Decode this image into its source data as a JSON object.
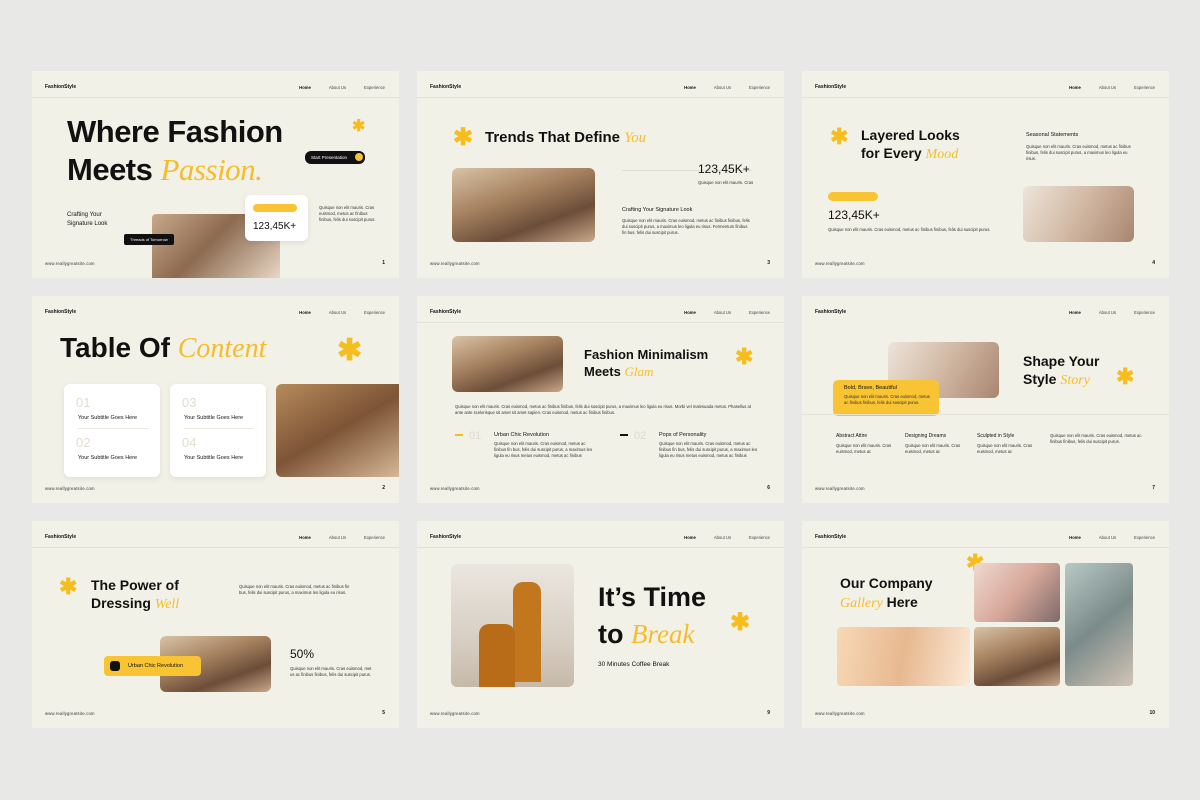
{
  "common": {
    "brand": "FashionStyle",
    "nav": [
      "Home",
      "About Us",
      "Experience"
    ],
    "site": "www.reallygreatsite.com"
  },
  "s1": {
    "title1": "Where Fashion",
    "title2": "Meets",
    "title_accent": "Passion.",
    "sub": "Crafting Your Signature Look",
    "btn": "Start Presentation",
    "stat": "123,45K+",
    "pill": "Threads of Tomorrow",
    "body": "Quisque non elit mauris. Cras euismod, metus ac finibus finibus, felis dui suscipit purus.",
    "page": "1"
  },
  "s2": {
    "title1": "Trends That Define",
    "title_accent": "You",
    "stat": "123,45K+",
    "stat_note": "Quisque non elit mauris. Cras",
    "sub": "Crafting Your Signature Look",
    "body": "Quisque non elit mauris. Cras euismod, metus ac finibus finibus, felis dui suscipit purus, a maximus leo ligula eu risus. Fermentum finibus fin bus, felis dui suscipit purus.",
    "page": "3"
  },
  "s3": {
    "title1": "Layered Looks",
    "title2": "for Every",
    "title_accent": "Mood",
    "stat": "123,45K+",
    "right_head": "Seasonal Statements",
    "right_body": "Quisque non elit mauris. Cras euismod, metus ac finibus finibus, felis dui suscipit purus, a maximus leo ligula eu risus.",
    "body": "Quisque non elit mauris. Cras euismod, metus ac finibus finibus, felis dui suscipit purus.",
    "page": "4"
  },
  "s4": {
    "title1": "Table Of",
    "title_accent": "Content",
    "items": [
      {
        "n": "01",
        "t": "Your Subtitle Goes Here"
      },
      {
        "n": "02",
        "t": "Your Subtitle Goes Here"
      },
      {
        "n": "03",
        "t": "Your Subtitle Goes Here"
      },
      {
        "n": "04",
        "t": "Your Subtitle Goes Here"
      }
    ],
    "page": "2"
  },
  "s5": {
    "title1": "Fashion Minimalism",
    "title2": "Meets",
    "title_accent": "Glam",
    "body": "Quisque non elit mauris. Cras euismod, metus ac finibus finibus, felis dui suscipit purus, a maximus leo ligula eu risus. Morbi vel malesuada metus. Phasellus at ante ante scelerisque sit amet sit amet sapien. Cras euismod, metus ac finibus finibus.",
    "c1n": "01",
    "c1h": "Urban Chic Revolution",
    "c1b": "Quisque non elit mauris. Cras euismod, metus ac finibus fin bus, felis dui suscipit purus, a maximus leo ligula eu risus metus euismod, metus ac finibus",
    "c2n": "02",
    "c2h": "Pops of Personality",
    "c2b": "Quisque non elit mauris. Cras euismod, metus ac finibus fin bus, felis dui suscipit purus, a maximus leo ligula eu risus metus euismod, metus ac finibus",
    "page": "6"
  },
  "s6": {
    "title1": "Shape Your",
    "title2": "Style",
    "title_accent": "Story",
    "badge_h": "Bold, Brave, Beautiful",
    "badge_b": "Quisque non elit mauris. Cras euismod, metus ac finibus finibus, felis dui suscipit purus.",
    "cols": [
      {
        "h": "Abstract Attire",
        "b": "Quisque non elit mauris. Cras euismod, metus ac"
      },
      {
        "h": "Designing Dreams",
        "b": "Quisque non elit mauris. Cras euismod, metus ac"
      },
      {
        "h": "Sculpted in Style",
        "b": "Quisque non elit mauris. Cras euismod, metus ac"
      }
    ],
    "right": "Quisque non elit mauris. Cras euismod, metus ac finibus finibus, felis dui suscipit purus.",
    "page": "7"
  },
  "s7": {
    "title1": "The Power of",
    "title2": "Dressing",
    "title_accent": "Well",
    "body": "Quisque non elit mauris. Cras euismod, metus ac finibus fin bus, felis dui suscipit purus, a maximus leo ligula eu risus.",
    "badge": "Urban Chic Revolution",
    "stat": "50%",
    "stat_body": "Quisque non elit mauris. Cras euismod, met us ac finibus finibus, felis dui suscipit purus.",
    "page": "5"
  },
  "s8": {
    "title1": "It’s Time",
    "title2": "to",
    "title_accent": "Break",
    "sub": "30 Minutes Coffee Break",
    "page": "9"
  },
  "s9": {
    "title1": "Our Company",
    "title_accent": "Gallery",
    "title2": "Here",
    "page": "10"
  }
}
